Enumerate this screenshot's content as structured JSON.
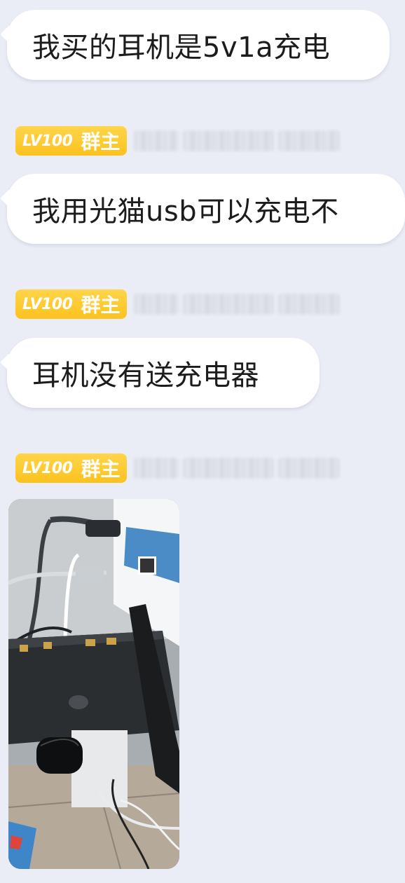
{
  "messages": [
    {
      "type": "text",
      "text": "我买的耳机是5v1a充电"
    },
    {
      "type": "text",
      "sender_badge": {
        "level": "LV100",
        "role": "群主"
      },
      "text": "我用光猫usb可以充电不"
    },
    {
      "type": "text",
      "sender_badge": {
        "level": "LV100",
        "role": "群主"
      },
      "text": "耳机没有送充电器"
    },
    {
      "type": "image",
      "sender_badge": {
        "level": "LV100",
        "role": "群主"
      },
      "image_description": "photo"
    }
  ],
  "colors": {
    "background": "#ebedf6",
    "bubble": "#ffffff",
    "badge": "#fcc21e"
  }
}
